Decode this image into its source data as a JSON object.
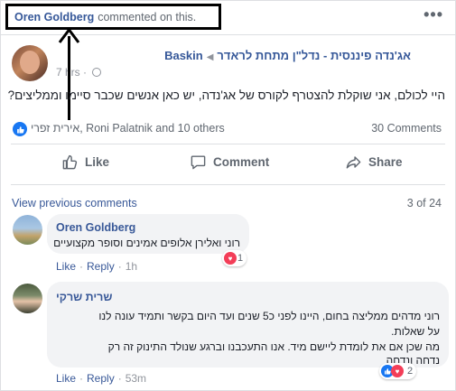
{
  "notice": {
    "actor": "Oren Goldberg",
    "action": "commented on this."
  },
  "post": {
    "author": "Baskin",
    "group": "אג'נדה פיננסית - נדל\"ן מתחת לראדר",
    "time": "7 hrs",
    "text": "היי לכולם, אני שוקלת להצטרף לקורס של אג'נדה, יש כאן אנשים שכבר סיימו וממליצים?",
    "reactors_hebrew": "אירית זפרי",
    "reactors_rest": ", Roni Palatnik and 10 others",
    "comment_count": "30 Comments"
  },
  "actions": {
    "like": "Like",
    "comment": "Comment",
    "share": "Share"
  },
  "comments_header": {
    "view_previous": "View previous comments",
    "pager": "3 of 24"
  },
  "comments": [
    {
      "name": "Oren Goldberg",
      "text": "רוני ואלירן אלופים אמינים וסופר מקצועיים",
      "reaction_count": "1",
      "like": "Like",
      "reply": "Reply",
      "time": "1h"
    },
    {
      "name": "שרית שרקי",
      "lines": [
        "רוני מדהים ממליצה בחום, היינו לפני כ5 שנים ועד היום בקשר ותמיד עונה לנו",
        "על שאלות.",
        "מה שכן אם את לומדת ליישם מיד. אנו התעכבנו וברגע שנולד התינוק זה רק",
        "נדחה ונדחה"
      ],
      "reaction_count": "2",
      "like": "Like",
      "reply": "Reply",
      "time": "53m"
    }
  ],
  "colors": {
    "link": "#385898",
    "muted": "#606770",
    "like_blue": "#1877f2",
    "love_red": "#f33e58"
  }
}
